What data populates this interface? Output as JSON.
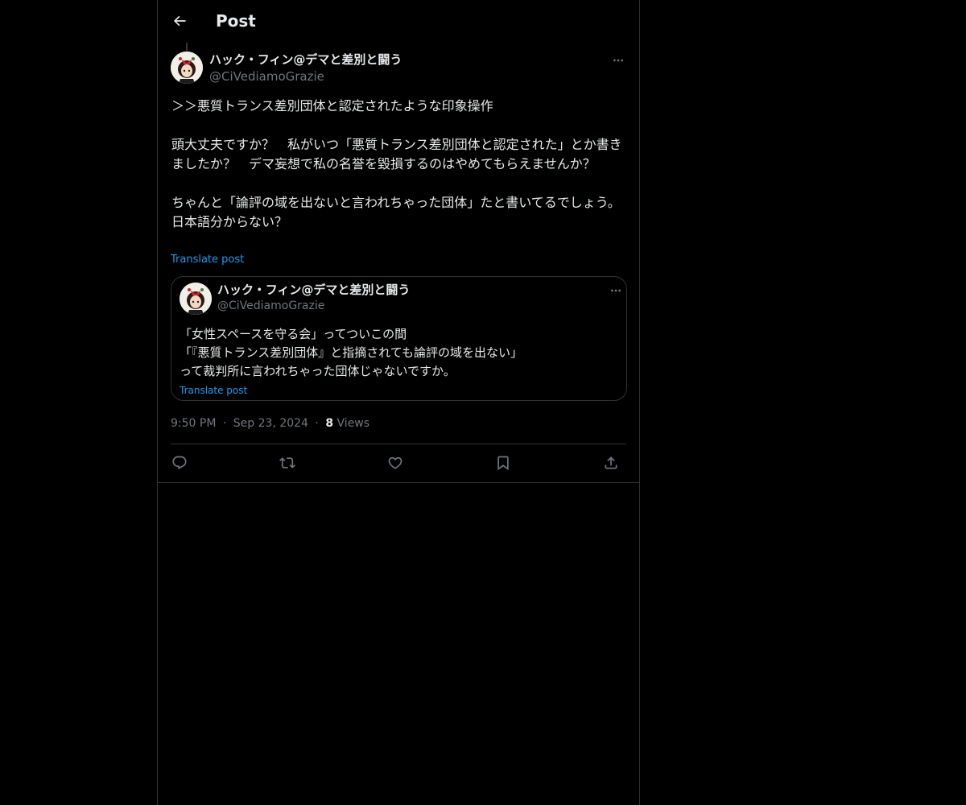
{
  "header": {
    "title": "Post"
  },
  "post": {
    "author_name": "ハック・フィン@デマと差別と闘う",
    "author_handle": "@CiVediamoGrazie",
    "text": "＞＞悪質トランス差別団体と認定されたような印象操作\n\n頭大丈夫ですか？　私がいつ「悪質トランス差別団体と認定された」とか書きましたか？　デマ妄想で私の名誉を毀損するのはやめてもらえませんか？\n\nちゃんと「論評の域を出ないと言われちゃった団体」たと書いてるでしょう。日本語分からない？",
    "translate_label": "Translate post",
    "time": "9:50 PM",
    "date": "Sep 23, 2024",
    "separator": "·",
    "views_count": "8",
    "views_label": "Views"
  },
  "quote": {
    "author_name": "ハック・フィン@デマと差別と闘う",
    "author_handle": "@CiVediamoGrazie",
    "text": "「女性スペースを守る会」ってついこの間\n「『悪質トランス差別団体』と指摘されても論評の域を出ない」\nって裁判所に言われちゃった団体じゃないですか。",
    "translate_label": "Translate post"
  },
  "icons": {
    "back": "arrow-left-icon",
    "more": "more-horizontal-icon",
    "reply": "reply-icon",
    "repost": "repost-icon",
    "like": "heart-icon",
    "bookmark": "bookmark-icon",
    "share": "share-icon"
  },
  "colors": {
    "background": "#000000",
    "text": "#e7e9ea",
    "secondary_text": "#71767b",
    "link": "#1d9bf0",
    "border": "#2f3336"
  }
}
